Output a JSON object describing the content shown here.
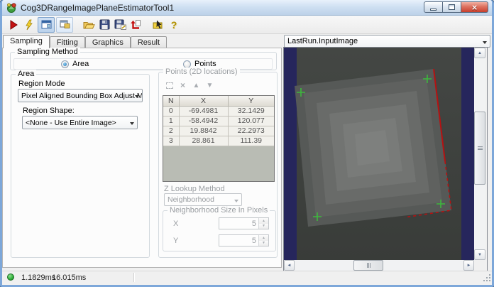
{
  "window": {
    "title": "Cog3DRangeImagePlaneEstimatorTool1"
  },
  "toolbar": {
    "icons": [
      "run",
      "auto-run",
      "show-image-display",
      "floating-editor",
      "open-file",
      "save-file",
      "save-as",
      "import-tool",
      "electric-run-params",
      "help"
    ]
  },
  "tabs": [
    "Sampling",
    "Fitting",
    "Graphics",
    "Result"
  ],
  "sampling_method": {
    "title": "Sampling Method",
    "area_label": "Area",
    "points_label": "Points"
  },
  "area_group": {
    "title": "Area",
    "region_mode_label": "Region Mode",
    "region_mode_value": "Pixel Aligned Bounding Box Adjust Mask",
    "region_shape_label": "Region Shape:",
    "region_shape_value": "<None - Use Entire Image>"
  },
  "points_group": {
    "title": "Points (2D locations)",
    "toolbar_icons": [
      "add-point",
      "delete-point",
      "move-up",
      "move-down"
    ],
    "table": {
      "headers": [
        "N",
        "X",
        "Y"
      ],
      "rows": [
        [
          "0",
          "-69.4981",
          "32.1429"
        ],
        [
          "1",
          "-58.4942",
          "120.077"
        ],
        [
          "2",
          "19.8842",
          "22.2973"
        ],
        [
          "3",
          "28.861",
          "111.39"
        ]
      ]
    },
    "z_lookup_label": "Z Lookup Method",
    "z_lookup_value": "Neighborhood",
    "size_group_title": "Neighborhood Size In Pixels",
    "x_label": "X",
    "x_value": "5",
    "y_label": "Y",
    "y_value": "5"
  },
  "display": {
    "selector_value": "LastRun.InputImage",
    "marker_color": "#3db83d",
    "edge_color": "#b51212",
    "side_band_color": "#26265c"
  },
  "status": {
    "time1": "1.1829ms",
    "time2": "16.015ms"
  }
}
